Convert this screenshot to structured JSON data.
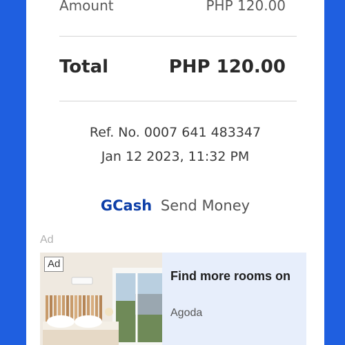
{
  "receipt": {
    "amount_label": "Amount",
    "amount_value": "PHP 120.00",
    "total_label": "Total",
    "total_value": "PHP 120.00",
    "ref_no": "Ref. No. 0007 641 483347",
    "datetime": "Jan 12 2023, 11:32 PM",
    "brand": "GCash",
    "brand_sub": "Send Money"
  },
  "ad": {
    "label": "Ad",
    "badge": "Ad",
    "title": "Find more rooms on",
    "source": "Agoda"
  },
  "colors": {
    "frame": "#1f5fe0",
    "brand": "#0e3fa8",
    "ad_bg": "#e7eefb"
  }
}
